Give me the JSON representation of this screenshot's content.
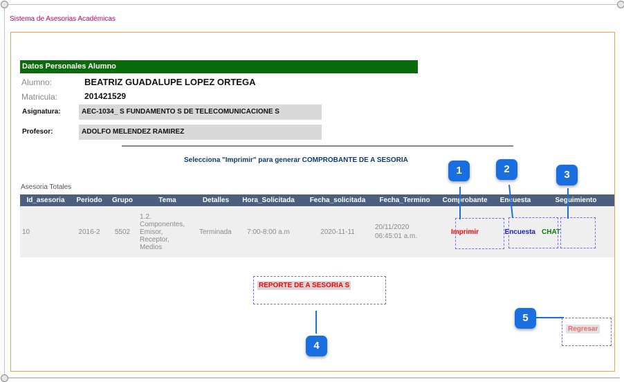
{
  "app": {
    "title": "Sistema de Asesorias Académicas"
  },
  "student": {
    "section_title": "Datos Personales Alumno",
    "alumno_label": "Alumno:",
    "alumno_value": "BEATRIZ GUADALUPE LOPEZ ORTEGA",
    "matricula_label": "Matricula:",
    "matricula_value": "201421529",
    "asignatura_label": "Asignatura:",
    "asignatura_value": "AEC-1034_ S FUNDAMENTO S DE TELECOMUNICACIONE S",
    "profesor_label": "Profesor:",
    "profesor_value": "ADOLFO MELENDEZ RAMIREZ"
  },
  "instruction": "Selecciona \"Imprimir\" para generar COMPROBANTE DE A SESORIA",
  "table": {
    "caption": "Asesoria Totales",
    "headers": [
      "Id_asesoria",
      "Periodo",
      "Grupo",
      "Tema",
      "Detalles",
      "Hora_Solicitada",
      "Fecha_solicitada",
      "Fecha_Termino",
      "Comprobante",
      "Encuesta",
      "Seguimiento"
    ],
    "row": {
      "id": "10",
      "periodo": "2016-2",
      "grupo": "5502",
      "tema": [
        "1.2.",
        "Componentes,",
        "Emisor,",
        "Receptor,",
        "Medios"
      ],
      "detalles": "Terminada",
      "hora": "7:00-8:00 a.m",
      "fecha_solicitada": "2020-11-11",
      "fecha_termino_date": "20/11/2020",
      "fecha_termino_time": "06:45:01 a.m.",
      "comprobante": "Imprimir",
      "encuesta": "Encuesta",
      "seguimiento": "CHAT"
    }
  },
  "buttons": {
    "reporte": "REPORTE DE A SESORIA S",
    "regresar": "Regresar"
  },
  "callouts": [
    "1",
    "2",
    "3",
    "4",
    "5"
  ],
  "colors": {
    "header_green": "#0a6b0a",
    "table_header": "#4a607e",
    "callout_blue": "#1a6fe0",
    "frame_orange": "#f2a24a",
    "link_red": "#ff0000"
  }
}
